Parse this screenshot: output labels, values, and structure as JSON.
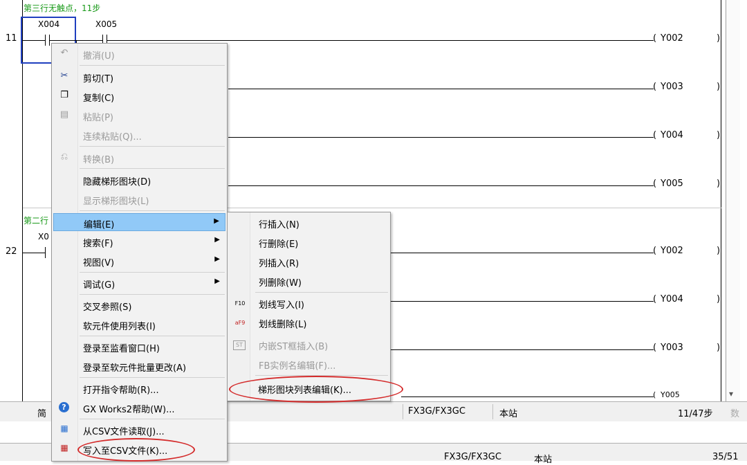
{
  "ladder": {
    "comment_row3": "第三行无触点，11步",
    "comment_row2": "第二行",
    "step_11": "11",
    "step_22": "22",
    "contact_x004": "X004",
    "contact_x005": "X005",
    "contact_x0_partial": "X0",
    "coils": [
      "Y002",
      "Y003",
      "Y004",
      "Y005",
      "Y002",
      "Y004",
      "Y003",
      "Y005"
    ]
  },
  "status_bar": {
    "left_partial": "简",
    "plc_model": "FX3G/FX3GC",
    "station": "本站",
    "steps": "11/47步",
    "extra": "数"
  },
  "status_bar_bottom": {
    "plc_model": "FX3G/FX3GC",
    "station": "本站",
    "steps": "35/51"
  },
  "context_menu": {
    "items": [
      {
        "label": "撤消(U)",
        "icon": "undo-icon",
        "disabled": true
      },
      {
        "label": "剪切(T)",
        "icon": "scissors-icon",
        "disabled": false
      },
      {
        "label": "复制(C)",
        "icon": "copy-icon",
        "disabled": false
      },
      {
        "label": "粘贴(P)",
        "icon": "paste-icon",
        "disabled": true
      },
      {
        "label": "连续粘贴(Q)...",
        "icon": "",
        "disabled": true
      },
      {
        "label": "转换(B)",
        "icon": "convert-icon",
        "disabled": true
      },
      {
        "label": "隐藏梯形图块(D)",
        "icon": "",
        "disabled": false
      },
      {
        "label": "显示梯形图块(L)",
        "icon": "",
        "disabled": true
      },
      {
        "label": "编辑(E)",
        "icon": "",
        "disabled": false
      },
      {
        "label": "搜索(F)",
        "icon": "",
        "disabled": false
      },
      {
        "label": "视图(V)",
        "icon": "",
        "disabled": false
      },
      {
        "label": "调试(G)",
        "icon": "",
        "disabled": false
      },
      {
        "label": "交叉参照(S)",
        "icon": "",
        "disabled": false
      },
      {
        "label": "软元件使用列表(I)",
        "icon": "",
        "disabled": false
      },
      {
        "label": "登录至监看窗口(H)",
        "icon": "",
        "disabled": false
      },
      {
        "label": "登录至软元件批量更改(A)",
        "icon": "",
        "disabled": false
      },
      {
        "label": "打开指令帮助(R)...",
        "icon": "",
        "disabled": false
      },
      {
        "label": "GX Works2帮助(W)...",
        "icon": "help-icon",
        "disabled": false
      },
      {
        "label": "从CSV文件读取(J)...",
        "icon": "csv-read-icon",
        "disabled": false
      },
      {
        "label": "写入至CSV文件(K)...",
        "icon": "csv-write-icon",
        "disabled": false
      }
    ]
  },
  "submenu": {
    "items": [
      {
        "label": "行插入(N)",
        "disabled": false
      },
      {
        "label": "行删除(E)",
        "disabled": false
      },
      {
        "label": "列插入(R)",
        "disabled": false
      },
      {
        "label": "列删除(W)",
        "disabled": false
      },
      {
        "label": "划线写入(I)",
        "disabled": false,
        "icon_text": "F10"
      },
      {
        "label": "划线删除(L)",
        "disabled": false,
        "icon_text": "aF9"
      },
      {
        "label": "内嵌ST框插入(B)",
        "disabled": true,
        "icon_text": "ST"
      },
      {
        "label": "FB实例名编辑(F)...",
        "disabled": true
      },
      {
        "label": "梯形图块列表编辑(K)...",
        "disabled": false
      }
    ]
  },
  "colors": {
    "comment_green": "#1a9a1a",
    "highlight": "#91c9f7",
    "annotation_red": "#d42b2b",
    "cursor_blue": "#1f3fbf"
  }
}
